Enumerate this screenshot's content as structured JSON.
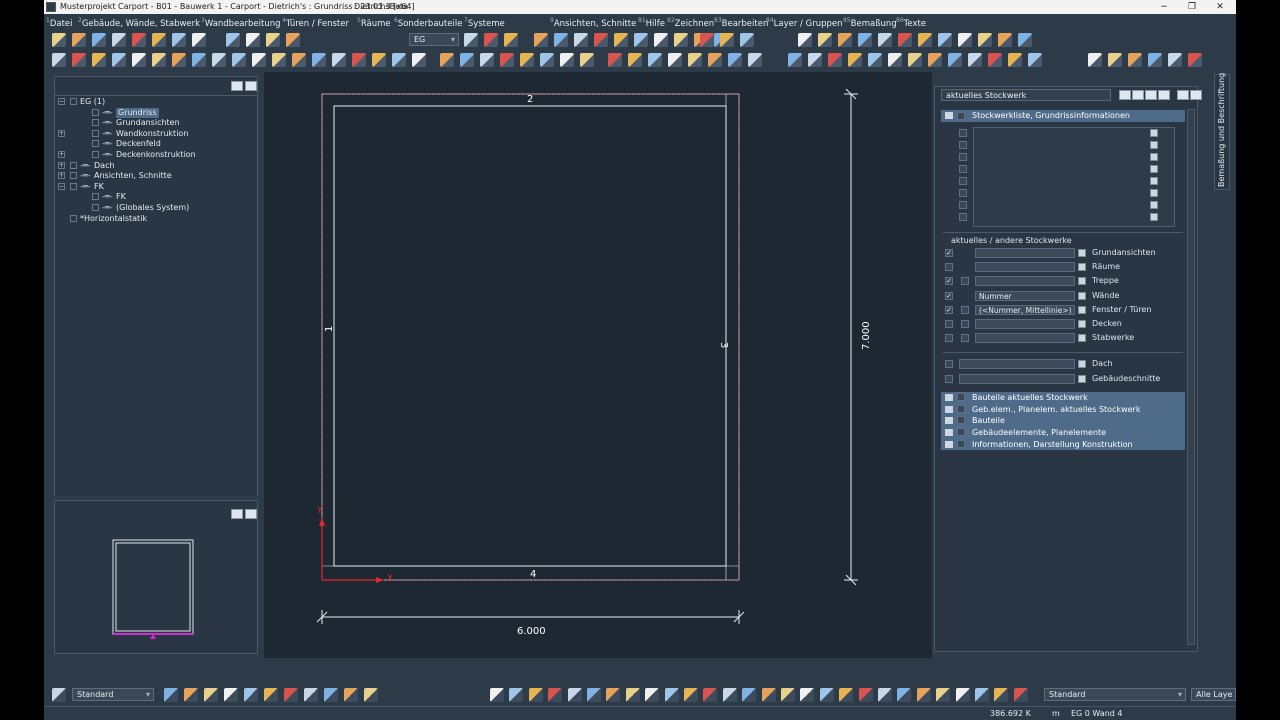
{
  "window": {
    "title": "Musterprojekt Carport - B01 - Bauwerk 1 - Carport - Dietrich's : Grundriss : 23.01.3 [x64]",
    "user": "DietrichsBeta",
    "min": "−",
    "max": "❐",
    "close": "✕"
  },
  "menu": [
    {
      "num": "1",
      "label": "Datei"
    },
    {
      "num": "2",
      "label": "Gebäude, Wände, Stabwerk"
    },
    {
      "num": "3",
      "label": "Wandbearbeitung"
    },
    {
      "num": "4",
      "label": "Türen / Fenster"
    },
    {
      "num": "5",
      "label": "Räume"
    },
    {
      "num": "6",
      "label": "Sonderbauteile"
    },
    {
      "num": "7",
      "label": "Systeme"
    },
    {
      "num": "9",
      "label": "Ansichten, Schnitte"
    },
    {
      "num": "81",
      "label": "Hilfe"
    },
    {
      "num": "82",
      "label": "Zeichnen"
    },
    {
      "num": "83",
      "label": "Bearbeiten"
    },
    {
      "num": "84",
      "label": "Layer / Gruppen"
    },
    {
      "num": "85",
      "label": "Bemaßung"
    },
    {
      "num": "86",
      "label": "Texte"
    }
  ],
  "toolbar": {
    "storey_select": "EG"
  },
  "tree": {
    "items": [
      {
        "label": "EG (1)",
        "level": 0,
        "exp": "−",
        "prefix": ""
      },
      {
        "label": "Grundriss",
        "level": 1,
        "exp": "",
        "prefix": "-═-",
        "selected": true
      },
      {
        "label": "Grundansichten",
        "level": 1,
        "exp": "",
        "prefix": "-═-"
      },
      {
        "label": "Wandkonstruktion",
        "level": 1,
        "exp": "+",
        "prefix": "-═-"
      },
      {
        "label": "Deckenfeld",
        "level": 1,
        "exp": "",
        "prefix": "-═-"
      },
      {
        "label": "Deckenkonstruktion",
        "level": 1,
        "exp": "+",
        "prefix": "-═-"
      },
      {
        "label": "Dach",
        "level": 0,
        "exp": "+",
        "prefix": "-═-"
      },
      {
        "label": "Ansichten, Schnitte",
        "level": 0,
        "exp": "+",
        "prefix": "-═-"
      },
      {
        "label": "FK",
        "level": 0,
        "exp": "−",
        "prefix": "-═-"
      },
      {
        "label": "FK",
        "level": 1,
        "exp": "",
        "prefix": "-═-"
      },
      {
        "label": "(Globales System)",
        "level": 1,
        "exp": "",
        "prefix": "-═-"
      },
      {
        "label": "*Horizontalstatik",
        "level": 0,
        "exp": "",
        "prefix": ""
      }
    ]
  },
  "drawing": {
    "edge_top": "2",
    "edge_left": "1",
    "edge_right": "3",
    "edge_bottom": "4",
    "dim_width": "6.000",
    "dim_height": "7.000",
    "axis_y": "Y",
    "axis_x": "X"
  },
  "right_panel": {
    "title": "aktuelles Stockwerk",
    "storey_list_header": "Stockwerkliste, Grundrissinformationen",
    "section_label": "aktuelles / andere Stockwerke",
    "rows": [
      {
        "label": "Grundansichten",
        "checked": true,
        "field": ""
      },
      {
        "label": "Räume",
        "checked": false,
        "field": ""
      },
      {
        "label": "Treppe",
        "checked": true,
        "field": ""
      },
      {
        "label": "Wände",
        "checked": true,
        "field": "Nummer"
      },
      {
        "label": "Fenster / Türen",
        "checked": true,
        "field": "(<Nummer, Mittellinie>)"
      },
      {
        "label": "Decken",
        "checked": false,
        "field": ""
      },
      {
        "label": "Stabwerke",
        "checked": false,
        "field": ""
      }
    ],
    "rows2": [
      {
        "label": "Dach",
        "checked": false
      },
      {
        "label": "Gebäudeschnitte",
        "checked": false
      }
    ],
    "groups": [
      "Bauteile aktuelles Stockwerk",
      "Geb.elem., Planelem. aktuelles Stockwerk",
      "Bauteile",
      "Gebäudeelemente, Planelemente",
      "Informationen, Darstellung Konstruktion"
    ]
  },
  "side_tab": "Bemaßung und Beschriftung",
  "bottom": {
    "line_style": "Standard",
    "text_style": "Standard",
    "layers": "Alle Laye"
  },
  "status": {
    "memory": "386.692 K",
    "unit": "m",
    "location": "EG 0 Wand 4"
  },
  "colors": {
    "background": "#2d3a48",
    "canvas": "#1e2833",
    "accent_red": "#e02a2a",
    "selection": "#4e6b89",
    "magenta": "#d02ad0"
  }
}
